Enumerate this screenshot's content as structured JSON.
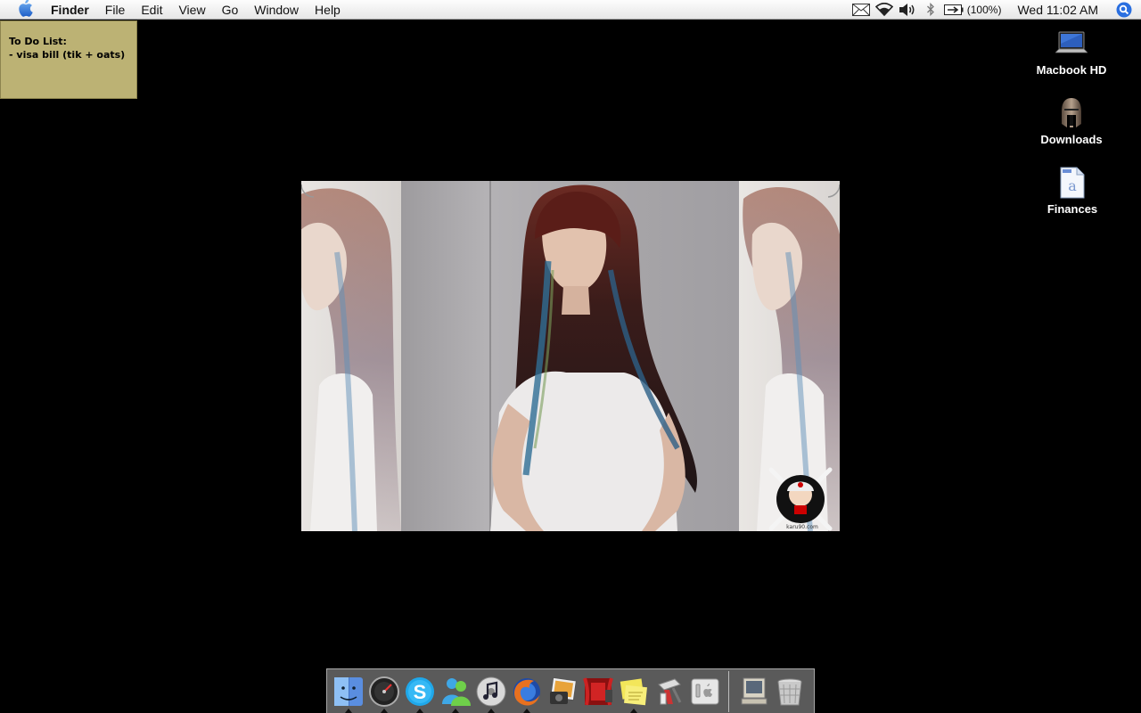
{
  "menubar": {
    "app_name": "Finder",
    "menus": [
      "File",
      "Edit",
      "View",
      "Go",
      "Window",
      "Help"
    ],
    "status": {
      "battery_percent": "(100%)",
      "clock": "Wed 11:02 AM"
    },
    "icons": [
      "apple-icon",
      "mail-icon",
      "wifi-icon",
      "volume-icon",
      "bluetooth-icon",
      "battery-icon",
      "spotlight-icon"
    ]
  },
  "sticky_note": {
    "title": "To Do List:",
    "line1": "- visa bill (tik + oats)"
  },
  "desktop_icons": [
    {
      "label": "Macbook HD",
      "icon": "laptop-drive-icon"
    },
    {
      "label": "Downloads",
      "icon": "spartan-helmet-icon"
    },
    {
      "label": "Finances",
      "icon": "document-icon"
    }
  ],
  "photo": {
    "description_panels": 3,
    "watermark": "karu90.com"
  },
  "dock": {
    "apps": [
      {
        "name": "finder-icon",
        "running": true
      },
      {
        "name": "dashboard-icon",
        "running": true
      },
      {
        "name": "skype-icon",
        "running": true
      },
      {
        "name": "msn-messenger-icon",
        "running": true
      },
      {
        "name": "itunes-icon",
        "running": true
      },
      {
        "name": "firefox-icon",
        "running": true
      },
      {
        "name": "iphoto-icon",
        "running": false
      },
      {
        "name": "front-row-icon",
        "running": false
      },
      {
        "name": "stickies-icon",
        "running": true
      },
      {
        "name": "script-editor-icon",
        "running": false
      },
      {
        "name": "system-preferences-icon",
        "running": false
      }
    ],
    "stack": [
      {
        "name": "computer-icon",
        "running": false
      },
      {
        "name": "trash-icon",
        "running": false
      }
    ]
  }
}
